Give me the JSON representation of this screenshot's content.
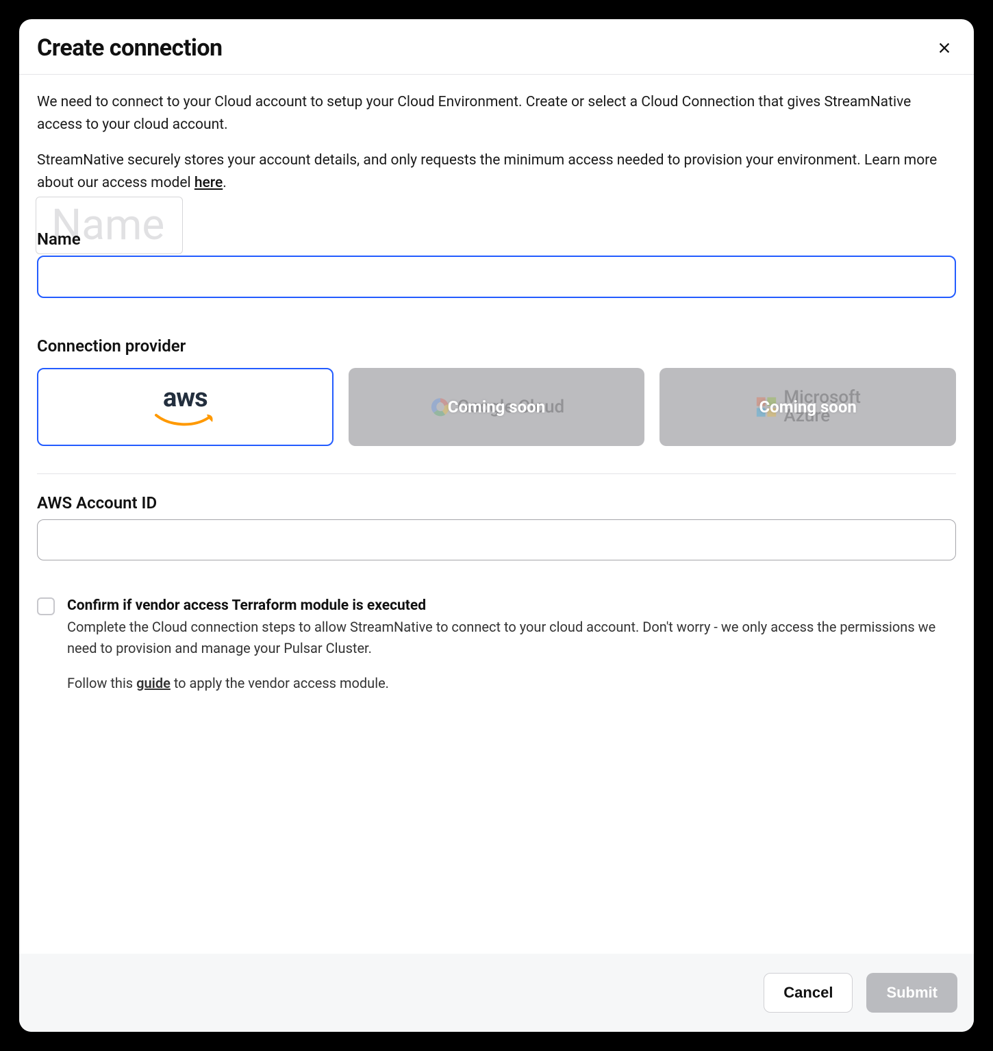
{
  "modal": {
    "title": "Create connection",
    "intro_p1": "We need to connect to your Cloud account to setup your Cloud Environment. Create or select a Cloud Connection that gives StreamNative access to your cloud account.",
    "intro_p2_a": "StreamNative securely stores your account details, and only requests the minimum access needed to provision your environment. Learn more about our access model ",
    "intro_link": "here",
    "intro_p2_b": "."
  },
  "name_field": {
    "label": "Name",
    "ghost": "Name",
    "value": ""
  },
  "providers": {
    "label": "Connection provider",
    "aws": {
      "name": "aws"
    },
    "gcp": {
      "name": "Google Cloud",
      "overlay": "Coming soon"
    },
    "azure": {
      "name_top": "Microsoft",
      "name_bottom": "Azure",
      "overlay": "Coming soon"
    }
  },
  "account": {
    "label": "AWS Account ID",
    "value": ""
  },
  "confirm": {
    "title": "Confirm if vendor access Terraform module is executed",
    "body": "Complete the Cloud connection steps to allow StreamNative to connect to your cloud account. Don't worry - we only access the permissions we need to provision and manage your Pulsar Cluster.",
    "follow_a": "Follow this ",
    "follow_link": "guide",
    "follow_b": " to apply the vendor access module."
  },
  "footer": {
    "cancel": "Cancel",
    "submit": "Submit"
  }
}
